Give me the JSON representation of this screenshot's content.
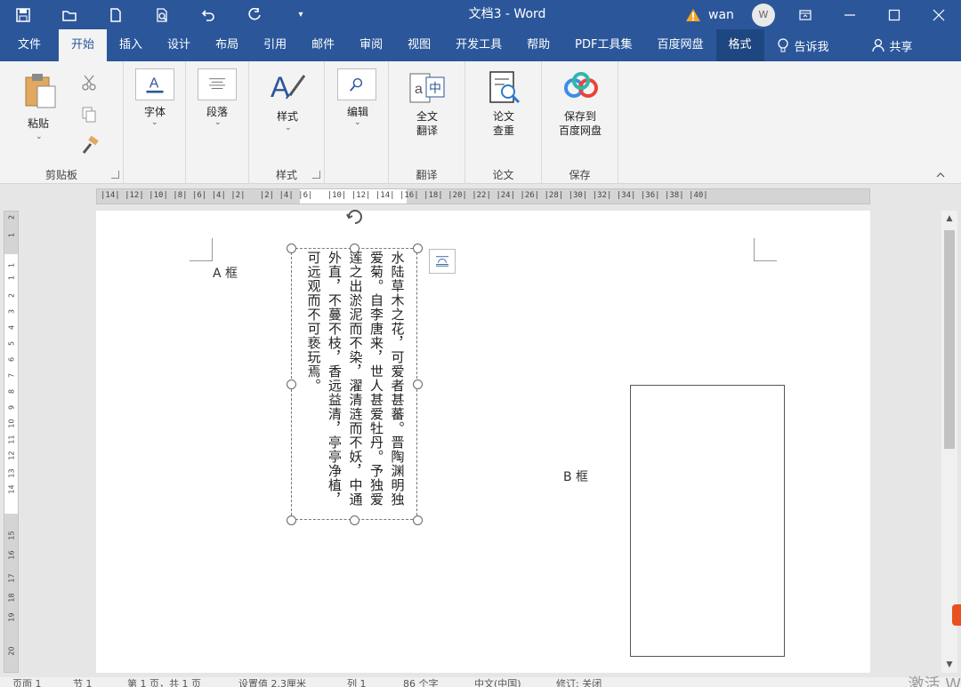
{
  "title_bar": {
    "doc_title": "文档3 - Word",
    "user_name": "wan",
    "avatar_letter": "W",
    "accent": "#2b579a"
  },
  "tabs": [
    {
      "label": "文件"
    },
    {
      "label": "开始"
    },
    {
      "label": "插入"
    },
    {
      "label": "设计"
    },
    {
      "label": "布局"
    },
    {
      "label": "引用"
    },
    {
      "label": "邮件"
    },
    {
      "label": "审阅"
    },
    {
      "label": "视图"
    },
    {
      "label": "开发工具"
    },
    {
      "label": "帮助"
    },
    {
      "label": "PDF工具集"
    },
    {
      "label": "百度网盘"
    },
    {
      "label": "格式"
    }
  ],
  "tell_me": "告诉我",
  "share": "共享",
  "ribbon": {
    "clipboard": {
      "paste": "粘贴",
      "group": "剪贴板"
    },
    "font": {
      "label": "字体"
    },
    "paragraph": {
      "label": "段落"
    },
    "styles": {
      "label": "样式",
      "group": "样式"
    },
    "editing": {
      "label": "编辑"
    },
    "translate": {
      "label1": "全文",
      "label2": "翻译",
      "group": "翻译"
    },
    "paper": {
      "label1": "论文",
      "label2": "查重",
      "group": "论文"
    },
    "save": {
      "label1": "保存到",
      "label2": "百度网盘",
      "group": "保存"
    }
  },
  "ruler": {
    "horizontal": "|14| |12| |10| |8| |6| |4| |2|   |2| |4| |6|   |10| |12| |14| |16| |18| |20| |22| |24| |26| |28| |30| |32| |34| |36| |38| |40|",
    "vertical": [
      "2",
      "1",
      "1",
      "1",
      "2",
      "3",
      "4",
      "5",
      "6",
      "7",
      "8",
      "9",
      "10",
      "11",
      "12",
      "13",
      "14",
      "15",
      "16",
      "17",
      "18",
      "19",
      "20"
    ]
  },
  "document": {
    "label_a": "A 框",
    "label_b": "B 框",
    "textbox_text": "水陆草木之花，可爱者甚蕃。晋陶渊明独爱菊。自李唐来，世人甚爱牡丹。予独爱莲之出淤泥而不染，濯清涟而不妖，中通外直，不蔓不枝，香远益清，亭亭净植，可远观而不可亵玩焉。"
  },
  "status": {
    "page": "页面 1",
    "section": "节 1",
    "pages": "第 1 页，共 1 页",
    "position": "设置值 2.3厘米",
    "row": "列 1",
    "words": "86 个字",
    "language": "中文(中国)",
    "track": "修订: 关闭",
    "activate": "激活 W"
  }
}
